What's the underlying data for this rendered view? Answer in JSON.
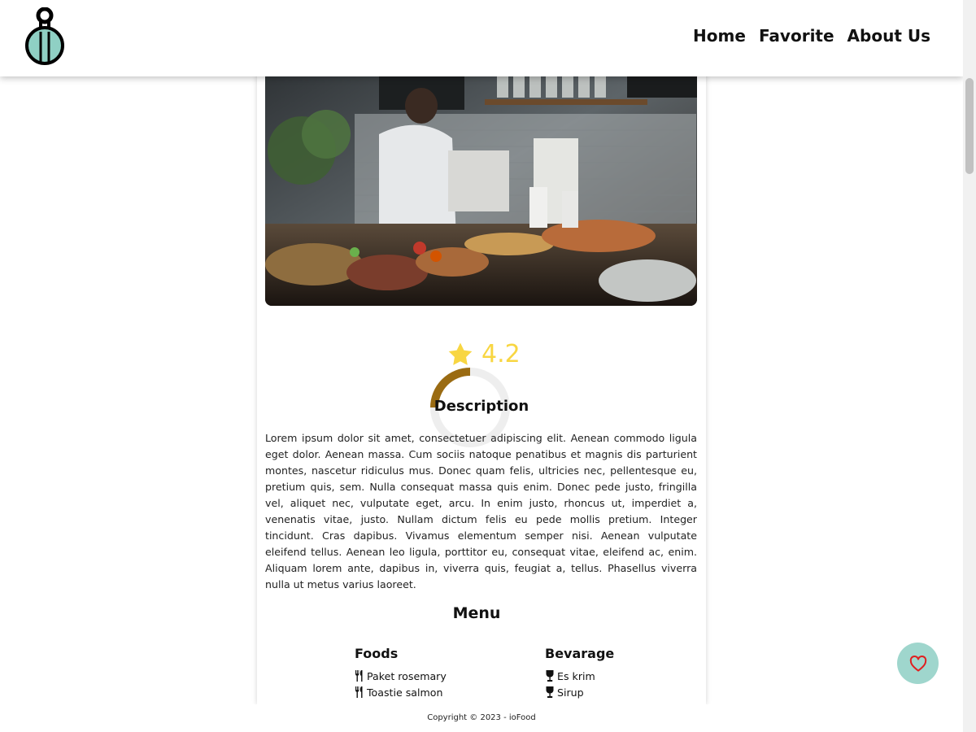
{
  "nav": {
    "items": [
      "Home",
      "Favorite",
      "About Us"
    ]
  },
  "rating": {
    "value": "4.2",
    "star_color": "#f8d642"
  },
  "description": {
    "heading": "Description",
    "text": "Lorem ipsum dolor sit amet, consectetuer adipiscing elit. Aenean commodo ligula eget dolor. Aenean massa. Cum sociis natoque penatibus et magnis dis parturient montes, nascetur ridiculus mus. Donec quam felis, ultricies nec, pellentesque eu, pretium quis, sem. Nulla consequat massa quis enim. Donec pede justo, fringilla vel, aliquet nec, vulputate eget, arcu. In enim justo, rhoncus ut, imperdiet a, venenatis vitae, justo. Nullam dictum felis eu pede mollis pretium. Integer tincidunt. Cras dapibus. Vivamus elementum semper nisi. Aenean vulputate eleifend tellus. Aenean leo ligula, porttitor eu, consequat vitae, eleifend ac, enim. Aliquam lorem ante, dapibus in, viverra quis, feugiat a, tellus. Phasellus viverra nulla ut metus varius laoreet."
  },
  "menu": {
    "heading": "Menu",
    "foods": {
      "heading": "Foods",
      "items": [
        "Paket rosemary",
        "Toastie salmon"
      ]
    },
    "beverage": {
      "heading": "Bevarage",
      "items": [
        "Es krim",
        "Sirup"
      ]
    }
  },
  "footer": {
    "copyright": "Copyright © 2023 - ioFood"
  },
  "colors": {
    "accent": "#9fd6cd",
    "heart": "#e02020",
    "spinner": "#9a6b12"
  },
  "icons": {
    "logo": "bottle-logo-icon",
    "food": "fork-knife-icon",
    "beverage": "wine-glass-icon",
    "favorite": "heart-icon",
    "rating": "star-icon"
  }
}
